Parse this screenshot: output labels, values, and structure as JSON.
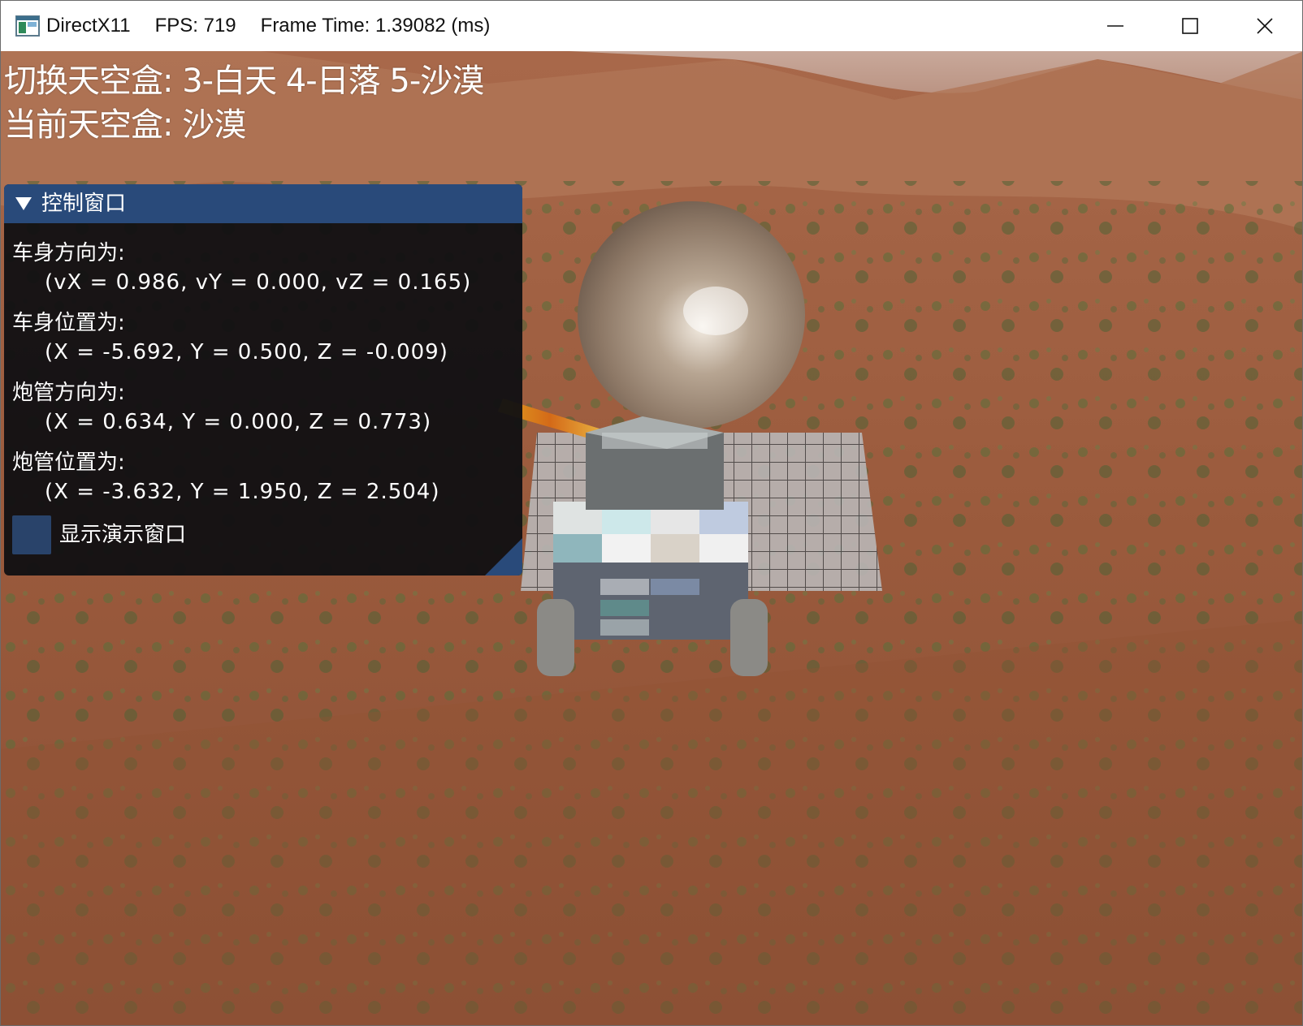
{
  "window": {
    "app_name": "DirectX11",
    "fps": "FPS: 719",
    "frame_time": "Frame Time: 1.39082 (ms)",
    "icon": "app-window-icon",
    "controls": [
      "minimize-icon",
      "maximize-icon",
      "close-icon"
    ]
  },
  "hud": {
    "switch_skybox": "切换天空盒: 3-白天 4-日落 5-沙漠",
    "current_skybox": "当前天空盒: 沙漠"
  },
  "control_panel": {
    "title": "控制窗口",
    "body_direction_label": "车身方向为:",
    "body_direction_value": "(vX = 0.986, vY = 0.000, vZ = 0.165)",
    "body_position_label": "车身位置为:",
    "body_position_value": "(X = -5.692, Y = 0.500, Z = -0.009)",
    "barrel_direction_label": "炮管方向为:",
    "barrel_direction_value": "(X = 0.634, Y = 0.000, Z = 0.773)",
    "barrel_position_label": "炮管位置为:",
    "barrel_position_value": "(X = -3.632, Y = 1.950, Z = 2.504)",
    "show_demo_label": "显示演示窗口",
    "show_demo_checked": false
  },
  "colors": {
    "panel_header": "#294a7a",
    "checkbox": "#29436a",
    "terrain": "#9c5a3c"
  }
}
